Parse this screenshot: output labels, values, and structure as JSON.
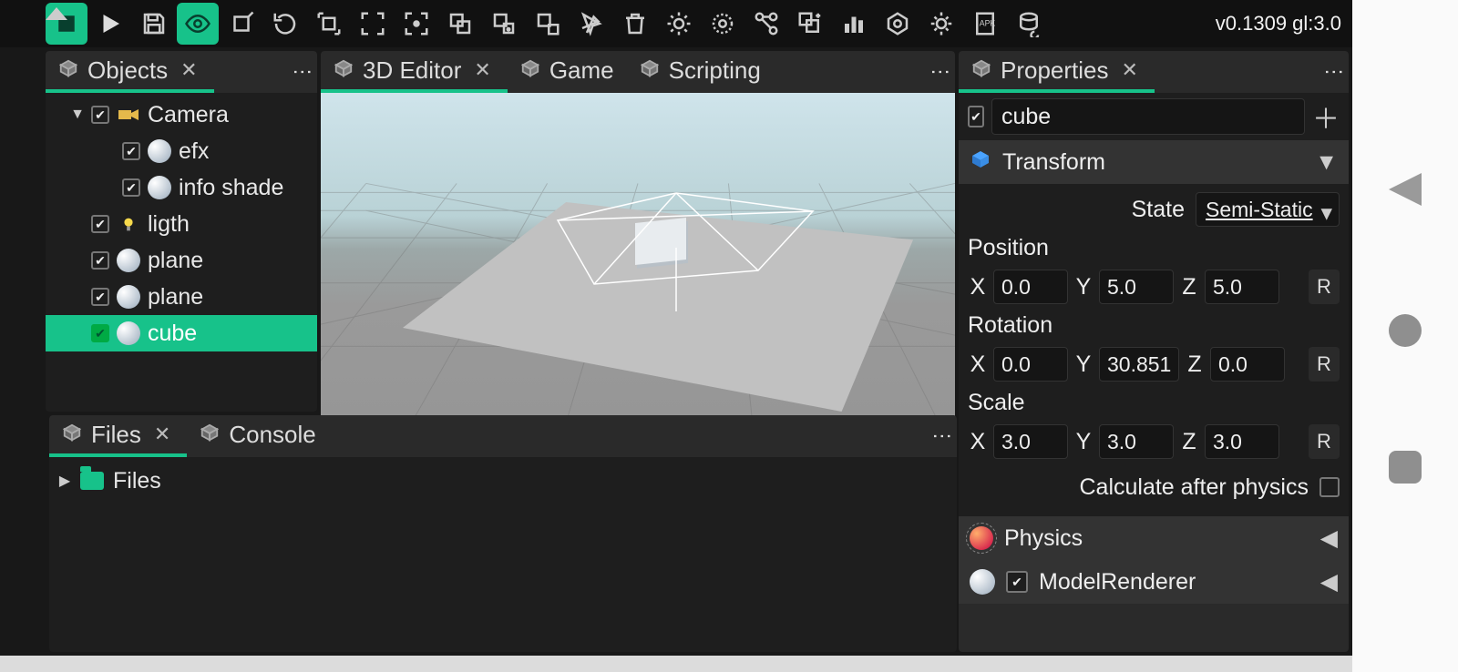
{
  "version": "v0.1309 gl:3.0",
  "leftPanel": {
    "tabs": [
      {
        "label": "Objects",
        "active": true,
        "closable": true
      }
    ],
    "tree": [
      {
        "label": "Camera",
        "type": "camera",
        "indent": 1,
        "expanded": true,
        "checked": true
      },
      {
        "label": "efx",
        "type": "sphere",
        "indent": 2,
        "checked": true
      },
      {
        "label": "info shade",
        "type": "sphere",
        "indent": 2,
        "checked": true
      },
      {
        "label": "ligth",
        "type": "light",
        "indent": 1,
        "checked": true
      },
      {
        "label": "plane",
        "type": "sphere",
        "indent": 1,
        "checked": true
      },
      {
        "label": "plane",
        "type": "sphere",
        "indent": 1,
        "checked": true
      },
      {
        "label": "cube",
        "type": "sphere",
        "indent": 1,
        "checked": true,
        "selected": true
      }
    ]
  },
  "centerPanel": {
    "tabs": [
      {
        "label": "3D Editor",
        "active": true,
        "closable": true
      },
      {
        "label": "Game",
        "active": false,
        "closable": false
      },
      {
        "label": "Scripting",
        "active": false,
        "closable": false
      }
    ]
  },
  "bottomPanel": {
    "tabs": [
      {
        "label": "Files",
        "active": true,
        "closable": true
      },
      {
        "label": "Console",
        "active": false,
        "closable": false
      }
    ],
    "rootLabel": "Files"
  },
  "rightPanel": {
    "tabs": [
      {
        "label": "Properties",
        "active": true,
        "closable": true
      }
    ],
    "objectName": "cube",
    "objectEnabled": true,
    "transform": {
      "title": "Transform",
      "stateLabel": "State",
      "stateValue": "Semi-Static",
      "positionLabel": "Position",
      "position": {
        "x": "0.0",
        "y": "5.0",
        "z": "5.0"
      },
      "rotationLabel": "Rotation",
      "rotation": {
        "x": "0.0",
        "y": "30.851",
        "z": "0.0"
      },
      "scaleLabel": "Scale",
      "scale": {
        "x": "3.0",
        "y": "3.0",
        "z": "3.0"
      },
      "calcLabel": "Calculate after physics",
      "calcValue": false,
      "resetLabel": "R"
    },
    "components": [
      {
        "title": "Physics",
        "collapsed": true,
        "icon": "physics"
      },
      {
        "title": "ModelRenderer",
        "collapsed": true,
        "icon": "sphere",
        "enabled": true
      }
    ]
  },
  "icons": {
    "x": "X",
    "y": "Y",
    "z": "Z"
  }
}
